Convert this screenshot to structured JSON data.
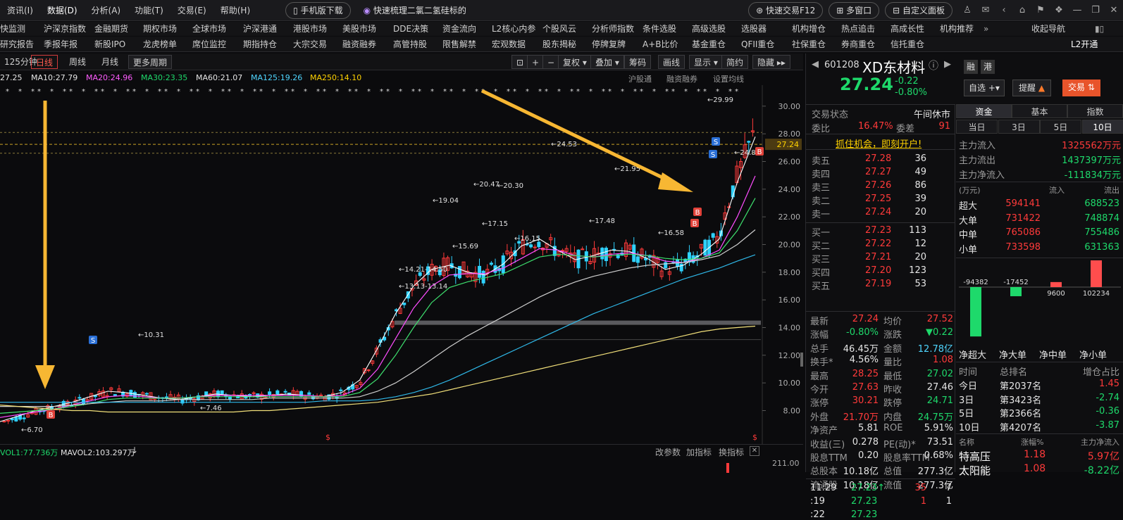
{
  "menubar": {
    "items": [
      "资讯(I)",
      "数据(D)",
      "分析(A)",
      "功能(T)",
      "交易(E)",
      "帮助(H)"
    ],
    "mobile_download": "手机版下载",
    "promo": "快速梳理二氯二氢硅标的",
    "quick_trade": "快速交易F12",
    "multi_window": "多窗口",
    "custom_panel": "自定义面板"
  },
  "nav1": [
    "快监测",
    "沪深京指数",
    "金融期货",
    "期权市场",
    "全球市场",
    "沪深港通",
    "港股市场",
    "美股市场",
    "DDE决策",
    "资金流向",
    "L2核心内参",
    "个股风云",
    "分析师指数",
    "条件选股",
    "高级选股",
    "选股器",
    "机构增仓",
    "热点追击",
    "高成长性",
    "机构推荐",
    "收起导航"
  ],
  "nav2": [
    "研究报告",
    "季报年报",
    "新股IPO",
    "龙虎榜单",
    "席位监控",
    "期指持仓",
    "大宗交易",
    "融资融券",
    "高管持股",
    "限售解禁",
    "宏观数据",
    "股东揭秘",
    "停牌复牌",
    "A+B比价",
    "基金重仓",
    "QFII重仓",
    "社保重仓",
    "券商重仓",
    "信托重仓",
    "L2开通"
  ],
  "chart_toolbar": {
    "period_label": "125分钟",
    "tabs": [
      "日线",
      "周线",
      "月线",
      "更多周期"
    ],
    "right_buttons": [
      "复权",
      "叠加",
      "筹码",
      "画线",
      "显示",
      "简约",
      "隐藏"
    ],
    "sub_links": [
      "沪股通",
      "融资融券",
      "设置均线"
    ]
  },
  "ma_line": {
    "first": "27.25",
    "ma10": "MA10:27.79",
    "ma20": "MA20:24.96",
    "ma30": "MA30:23.35",
    "ma60": "MA60:21.07",
    "ma125": "MA125:19.26",
    "ma250": "MA250:14.10"
  },
  "price_axis": [
    "30.00",
    "28.00",
    "26.00",
    "24.00",
    "22.00",
    "20.00",
    "18.00",
    "16.00",
    "14.00",
    "12.00",
    "10.00",
    "8.00"
  ],
  "current_price_tag": "27.24",
  "annotations": [
    "29.99",
    "24.53",
    "21.95",
    "20.47",
    "20.30",
    "19.04",
    "17.48",
    "17.15",
    "16.58",
    "16.15",
    "15.69",
    "14.21-14.50",
    "13.13-13.14",
    "10.31",
    "7.46",
    "6.70",
    "24.82"
  ],
  "chart_data": {
    "type": "line",
    "title": "",
    "ylim": [
      6.5,
      30.5
    ],
    "series": [
      {
        "name": "MA10",
        "values": [
          7.2,
          7.6,
          8.0,
          8.3,
          8.6,
          9.0,
          9.4,
          9.3,
          9.1,
          8.9,
          8.8,
          9.0,
          9.2,
          9.1,
          9.0,
          9.1,
          9.2,
          9.1,
          9.0,
          9.3,
          10.2,
          12.5,
          15.0,
          17.0,
          18.2,
          18.5,
          18.0,
          17.8,
          18.6,
          19.9,
          20.4,
          19.6,
          18.9,
          19.2,
          19.6,
          19.5,
          19.0,
          18.2,
          18.5,
          19.3,
          20.4,
          24.5,
          27.79
        ]
      },
      {
        "name": "MA20",
        "values": [
          7.5,
          7.7,
          7.9,
          8.1,
          8.4,
          8.7,
          9.0,
          9.1,
          9.0,
          8.9,
          8.9,
          9.0,
          9.1,
          9.1,
          9.1,
          9.1,
          9.1,
          9.1,
          9.0,
          9.1,
          9.6,
          11.0,
          13.2,
          15.4,
          17.0,
          17.8,
          17.9,
          17.9,
          18.3,
          19.0,
          19.7,
          19.6,
          19.2,
          19.1,
          19.3,
          19.4,
          19.2,
          18.8,
          18.7,
          19.0,
          19.6,
          22.0,
          24.96
        ]
      },
      {
        "name": "MA30",
        "values": [
          7.8,
          7.9,
          8.0,
          8.1,
          8.3,
          8.5,
          8.8,
          8.9,
          8.9,
          8.9,
          8.9,
          9.0,
          9.0,
          9.0,
          9.0,
          9.0,
          9.0,
          9.0,
          9.0,
          9.0,
          9.3,
          10.3,
          12.0,
          14.0,
          15.8,
          16.9,
          17.3,
          17.6,
          17.9,
          18.5,
          19.1,
          19.3,
          19.2,
          19.1,
          19.2,
          19.3,
          19.2,
          19.0,
          18.9,
          19.0,
          19.4,
          21.0,
          23.35
        ]
      },
      {
        "name": "MA60",
        "values": [
          8.3,
          8.3,
          8.3,
          8.3,
          8.4,
          8.5,
          8.6,
          8.7,
          8.7,
          8.7,
          8.8,
          8.8,
          8.8,
          8.8,
          8.8,
          8.9,
          8.9,
          8.9,
          8.9,
          8.9,
          9.0,
          9.4,
          10.0,
          10.8,
          11.7,
          12.6,
          13.4,
          14.1,
          14.8,
          15.5,
          16.2,
          16.8,
          17.3,
          17.7,
          18.0,
          18.3,
          18.5,
          18.6,
          18.7,
          18.9,
          19.2,
          20.0,
          21.07
        ]
      },
      {
        "name": "MA125",
        "values": [
          8.6,
          8.6,
          8.6,
          8.6,
          8.6,
          8.6,
          8.6,
          8.6,
          8.6,
          8.6,
          8.6,
          8.6,
          8.6,
          8.6,
          8.6,
          8.6,
          8.6,
          8.6,
          8.7,
          8.7,
          8.7,
          8.8,
          9.0,
          9.3,
          9.7,
          10.2,
          10.8,
          11.4,
          12.0,
          12.6,
          13.2,
          13.8,
          14.4,
          15.0,
          15.5,
          16.0,
          16.5,
          17.0,
          17.5,
          17.9,
          18.3,
          18.8,
          19.26
        ]
      },
      {
        "name": "MA250",
        "values": [
          8.4,
          8.3,
          8.2,
          8.1,
          8.0,
          8.0,
          7.9,
          7.9,
          7.9,
          7.9,
          7.9,
          7.9,
          7.9,
          7.9,
          8.0,
          8.0,
          8.1,
          8.2,
          8.3,
          8.4,
          8.5,
          8.6,
          8.8,
          9.0,
          9.2,
          9.5,
          9.8,
          10.1,
          10.4,
          10.7,
          11.0,
          11.3,
          11.6,
          11.9,
          12.2,
          12.5,
          12.8,
          13.1,
          13.4,
          13.7,
          13.9,
          14.0,
          14.1
        ]
      }
    ]
  },
  "volume_bar": {
    "vol1": "VOL1:77.736万",
    "mavol2": "MAVOL2:103.297万",
    "links": [
      "改参数",
      "加指标",
      "换指标"
    ],
    "axis_value": "211.00"
  },
  "stock": {
    "code": "601208",
    "name": "XD东材料",
    "buttons": [
      "融",
      "港"
    ],
    "price": "27.24",
    "change": "-0.22",
    "change_pct": "-0.80%",
    "watch_btn": "自选",
    "alert_btn": "提醒",
    "trade_btn": "交易"
  },
  "orderbook": {
    "status_label": "交易状态",
    "status_value": "午间休市",
    "webi_label": "委比",
    "webi_value": "16.47%",
    "weicha_label": "委差",
    "weicha_value": "91",
    "promo": "抓住机会，即刻开户!",
    "asks": [
      {
        "label": "卖五",
        "price": "27.28",
        "vol": "36"
      },
      {
        "label": "卖四",
        "price": "27.27",
        "vol": "49"
      },
      {
        "label": "卖三",
        "price": "27.26",
        "vol": "86"
      },
      {
        "label": "卖二",
        "price": "27.25",
        "vol": "39"
      },
      {
        "label": "卖一",
        "price": "27.24",
        "vol": "20"
      }
    ],
    "bids": [
      {
        "label": "买一",
        "price": "27.23",
        "vol": "113"
      },
      {
        "label": "买二",
        "price": "27.22",
        "vol": "12"
      },
      {
        "label": "买三",
        "price": "27.21",
        "vol": "20"
      },
      {
        "label": "买四",
        "price": "27.20",
        "vol": "123"
      },
      {
        "label": "买五",
        "price": "27.19",
        "vol": "53"
      }
    ]
  },
  "stats": [
    {
      "l1": "最新",
      "v1": "27.24",
      "c1": "r",
      "l2": "均价",
      "v2": "27.52",
      "c2": "r"
    },
    {
      "l1": "涨幅",
      "v1": "-0.80%",
      "c1": "g",
      "l2": "涨跌",
      "v2": "▼0.22",
      "c2": "g"
    },
    {
      "l1": "总手",
      "v1": "46.45万",
      "c1": "w",
      "l2": "金额",
      "v2": "12.78亿",
      "c2": "c"
    },
    {
      "l1": "换手*",
      "v1": "4.56%",
      "c1": "w",
      "l2": "量比",
      "v2": "1.08",
      "c2": "r"
    },
    {
      "l1": "最高",
      "v1": "28.25",
      "c1": "r",
      "l2": "最低",
      "v2": "27.02",
      "c2": "g"
    },
    {
      "l1": "今开",
      "v1": "27.63",
      "c1": "r",
      "l2": "昨收",
      "v2": "27.46",
      "c2": "w"
    },
    {
      "l1": "涨停",
      "v1": "30.21",
      "c1": "r",
      "l2": "跌停",
      "v2": "24.71",
      "c2": "g"
    },
    {
      "l1": "外盘",
      "v1": "21.70万",
      "c1": "r",
      "l2": "内盘",
      "v2": "24.75万",
      "c2": "g"
    },
    {
      "l1": "净资产",
      "v1": "5.81",
      "c1": "w",
      "l2": "ROE",
      "v2": "5.91%",
      "c2": "w"
    },
    {
      "l1": "收益(三)",
      "v1": "0.278",
      "c1": "w",
      "l2": "PE(动)*",
      "v2": "73.51",
      "c2": "w"
    },
    {
      "l1": "股息TTM",
      "v1": "0.20",
      "c1": "w",
      "l2": "股息率TTM",
      "v2": "0.68%",
      "c2": "w"
    },
    {
      "l1": "总股本",
      "v1": "10.18亿",
      "c1": "w",
      "l2": "总值",
      "v2": "277.3亿",
      "c2": "w"
    },
    {
      "l1": "流通股",
      "v1": "10.18亿",
      "c1": "w",
      "l2": "流值",
      "v2": "277.3亿",
      "c2": "w"
    }
  ],
  "ticks": [
    {
      "time": "11:29",
      "price": "27.23↑",
      "vol": "35",
      "n": "7"
    },
    {
      "time": ":19",
      "price": "27.23",
      "vol": "1",
      "n": "1"
    },
    {
      "time": ":22",
      "price": "27.23",
      "vol": "",
      "n": ""
    }
  ],
  "fund_panel": {
    "tabs": [
      "资金",
      "基本",
      "指数"
    ],
    "periods": [
      "当日",
      "3日",
      "5日",
      "10日"
    ],
    "main_in_label": "主力流入",
    "main_in": "1325562万元",
    "main_out_label": "主力流出",
    "main_out": "1437397万元",
    "main_net_label": "主力净流入",
    "main_net": "-111834万元",
    "unit": "(万元)",
    "in_label": "流入",
    "out_label": "流出",
    "rows": [
      {
        "label": "超大",
        "in": "594141",
        "out": "688523"
      },
      {
        "label": "大单",
        "in": "731422",
        "out": "748874"
      },
      {
        "label": "中单",
        "in": "765086",
        "out": "755486"
      },
      {
        "label": "小单",
        "in": "733598",
        "out": "631363"
      }
    ],
    "bars": [
      {
        "label": "净超大",
        "value": -94382,
        "text": "-94382"
      },
      {
        "label": "净大单",
        "value": -17452,
        "text": "-17452"
      },
      {
        "label": "净中单",
        "value": 9600,
        "text": "9600"
      },
      {
        "label": "净小单",
        "value": 102234,
        "text": "102234"
      }
    ],
    "rank_headers": [
      "时间",
      "总排名",
      "增仓占比"
    ],
    "ranks": [
      {
        "t": "今日",
        "rank": "第2037名",
        "pct": "1.45",
        "c": "r"
      },
      {
        "t": "3日",
        "rank": "第3423名",
        "pct": "-2.74",
        "c": "g"
      },
      {
        "t": "5日",
        "rank": "第2366名",
        "pct": "-0.36",
        "c": "g"
      },
      {
        "t": "10日",
        "rank": "第4207名",
        "pct": "-3.87",
        "c": "g"
      }
    ],
    "sector_headers": [
      "名称",
      "涨幅%",
      "主力净流入"
    ],
    "sectors": [
      {
        "name": "特高压",
        "chg": "1.18",
        "net": "5.97亿",
        "c": "r"
      },
      {
        "name": "太阳能",
        "chg": "1.08",
        "net": "-8.22亿",
        "c": "g"
      }
    ]
  },
  "colors": {
    "up": "#ff3a3a",
    "down": "#1ed96b",
    "accent": "#ffd200",
    "arrow": "#f7b733"
  }
}
